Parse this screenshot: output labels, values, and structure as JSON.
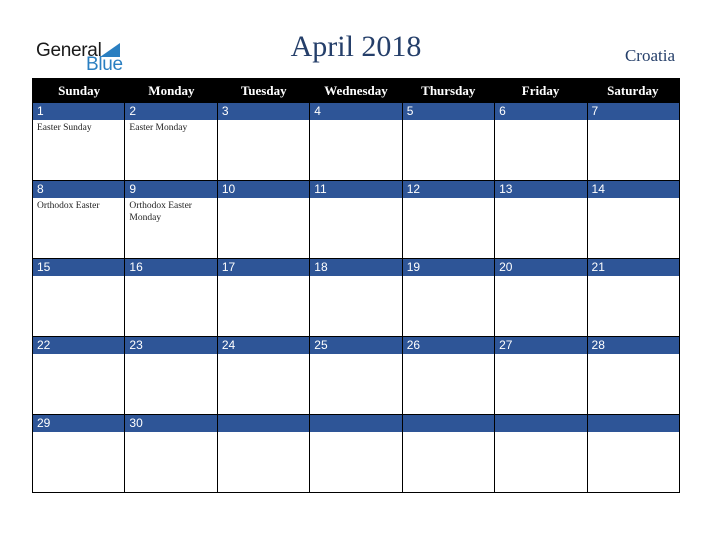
{
  "logo": {
    "line1": "General",
    "line2": "Blue"
  },
  "title": "April 2018",
  "country": "Croatia",
  "colors": {
    "header_bg": "#000000",
    "band_bg": "#2e5597",
    "title": "#253f6a",
    "logo_blue": "#2a7fc1"
  },
  "weekdays": [
    "Sunday",
    "Monday",
    "Tuesday",
    "Wednesday",
    "Thursday",
    "Friday",
    "Saturday"
  ],
  "weeks": [
    [
      {
        "day": "1",
        "event": "Easter Sunday"
      },
      {
        "day": "2",
        "event": "Easter Monday"
      },
      {
        "day": "3",
        "event": ""
      },
      {
        "day": "4",
        "event": ""
      },
      {
        "day": "5",
        "event": ""
      },
      {
        "day": "6",
        "event": ""
      },
      {
        "day": "7",
        "event": ""
      }
    ],
    [
      {
        "day": "8",
        "event": "Orthodox Easter"
      },
      {
        "day": "9",
        "event": "Orthodox Easter Monday"
      },
      {
        "day": "10",
        "event": ""
      },
      {
        "day": "11",
        "event": ""
      },
      {
        "day": "12",
        "event": ""
      },
      {
        "day": "13",
        "event": ""
      },
      {
        "day": "14",
        "event": ""
      }
    ],
    [
      {
        "day": "15",
        "event": ""
      },
      {
        "day": "16",
        "event": ""
      },
      {
        "day": "17",
        "event": ""
      },
      {
        "day": "18",
        "event": ""
      },
      {
        "day": "19",
        "event": ""
      },
      {
        "day": "20",
        "event": ""
      },
      {
        "day": "21",
        "event": ""
      }
    ],
    [
      {
        "day": "22",
        "event": ""
      },
      {
        "day": "23",
        "event": ""
      },
      {
        "day": "24",
        "event": ""
      },
      {
        "day": "25",
        "event": ""
      },
      {
        "day": "26",
        "event": ""
      },
      {
        "day": "27",
        "event": ""
      },
      {
        "day": "28",
        "event": ""
      }
    ],
    [
      {
        "day": "29",
        "event": ""
      },
      {
        "day": "30",
        "event": ""
      },
      {
        "day": "",
        "event": ""
      },
      {
        "day": "",
        "event": ""
      },
      {
        "day": "",
        "event": ""
      },
      {
        "day": "",
        "event": ""
      },
      {
        "day": "",
        "event": ""
      }
    ]
  ]
}
